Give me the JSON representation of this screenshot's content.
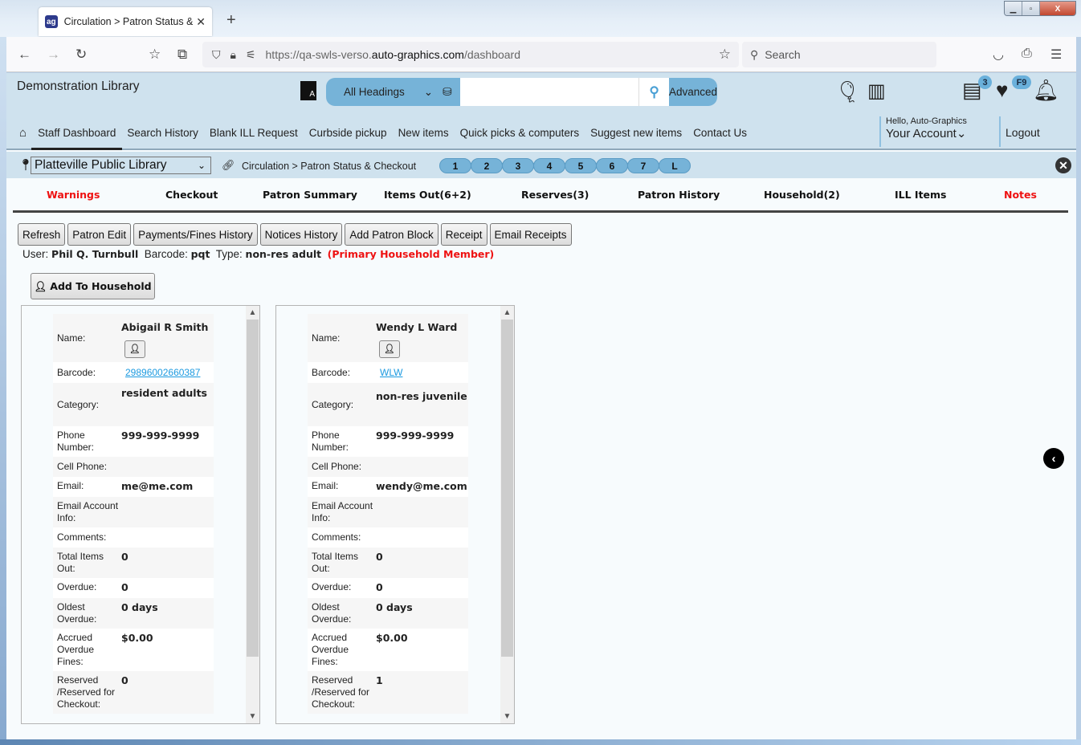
{
  "browser": {
    "tab_title": "Circulation > Patron Status & Checkout",
    "tab_favicon": "ag",
    "url_prefix": "https://qa-swls-verso.",
    "url_domain": "auto-graphics.com",
    "url_path": "/dashboard",
    "search_placeholder": "Search"
  },
  "header": {
    "library_name": "Demonstration Library",
    "search_scope": "All Headings",
    "search_value": "",
    "advanced_label": "Advanced",
    "list_badge": "3",
    "favorites_badge": "F9",
    "menu": [
      {
        "label": "Staff Dashboard",
        "active": true
      },
      {
        "label": "Search History"
      },
      {
        "label": "Blank ILL Request"
      },
      {
        "label": "Curbside pickup"
      },
      {
        "label": "New items"
      },
      {
        "label": "Quick picks & computers"
      },
      {
        "label": "Suggest new items"
      },
      {
        "label": "Contact Us"
      }
    ],
    "greeting": "Hello, Auto-Graphics",
    "account_label": "Your Account",
    "logout_label": "Logout"
  },
  "subbar": {
    "location": "Platteville Public Library",
    "breadcrumb": "Circulation > Patron Status & Checkout",
    "pills": [
      "1",
      "2",
      "3",
      "4",
      "5",
      "6",
      "7",
      "L"
    ]
  },
  "patron_tabs": [
    {
      "label": "Warnings",
      "color": "#ee1111"
    },
    {
      "label": "Checkout"
    },
    {
      "label": "Patron Summary"
    },
    {
      "label": "Items Out(6+2)"
    },
    {
      "label": "Reserves(3)"
    },
    {
      "label": "Patron History"
    },
    {
      "label": "Household(2)"
    },
    {
      "label": "ILL Items"
    },
    {
      "label": "Notes",
      "color": "#ee1111"
    }
  ],
  "actions": [
    "Refresh",
    "Patron Edit",
    "Payments/Fines History",
    "Notices History",
    "Add Patron Block",
    "Receipt",
    "Email Receipts"
  ],
  "user": {
    "user_label": "User:",
    "name": "Phil Q. Turnbull",
    "barcode_label": "Barcode:",
    "barcode": "pqt",
    "type_label": "Type:",
    "type": "non-res adult",
    "primary_note": "(Primary Household Member)"
  },
  "add_household_label": "Add To Household",
  "labels": {
    "name": "Name:",
    "barcode": "Barcode:",
    "category": "Category:",
    "phone": "Phone Number:",
    "cell": "Cell Phone:",
    "email": "Email:",
    "email_info": "Email Account Info:",
    "comments": "Comments:",
    "total_out": "Total Items Out:",
    "overdue": "Overdue:",
    "oldest_overdue": "Oldest Overdue:",
    "fines": "Accrued Overdue Fines:",
    "reserved": "Reserved /Reserved for Checkout:"
  },
  "members": [
    {
      "name": "Abigail R Smith",
      "barcode": "29896002660387",
      "category": "resident adults",
      "phone": "999-999-9999",
      "cell": "",
      "email": "me@me.com",
      "email_info": "",
      "comments": "",
      "total_out": "0",
      "overdue": "0",
      "oldest_overdue": "0 days",
      "fines": "$0.00",
      "reserved": "0"
    },
    {
      "name": "Wendy L Ward",
      "barcode": "WLW",
      "category": "non-res juvenile",
      "phone": "999-999-9999",
      "cell": "",
      "email": "wendy@me.com",
      "email_info": "",
      "comments": "",
      "total_out": "0",
      "overdue": "0",
      "oldest_overdue": "0 days",
      "fines": "$0.00",
      "reserved": "1"
    }
  ]
}
